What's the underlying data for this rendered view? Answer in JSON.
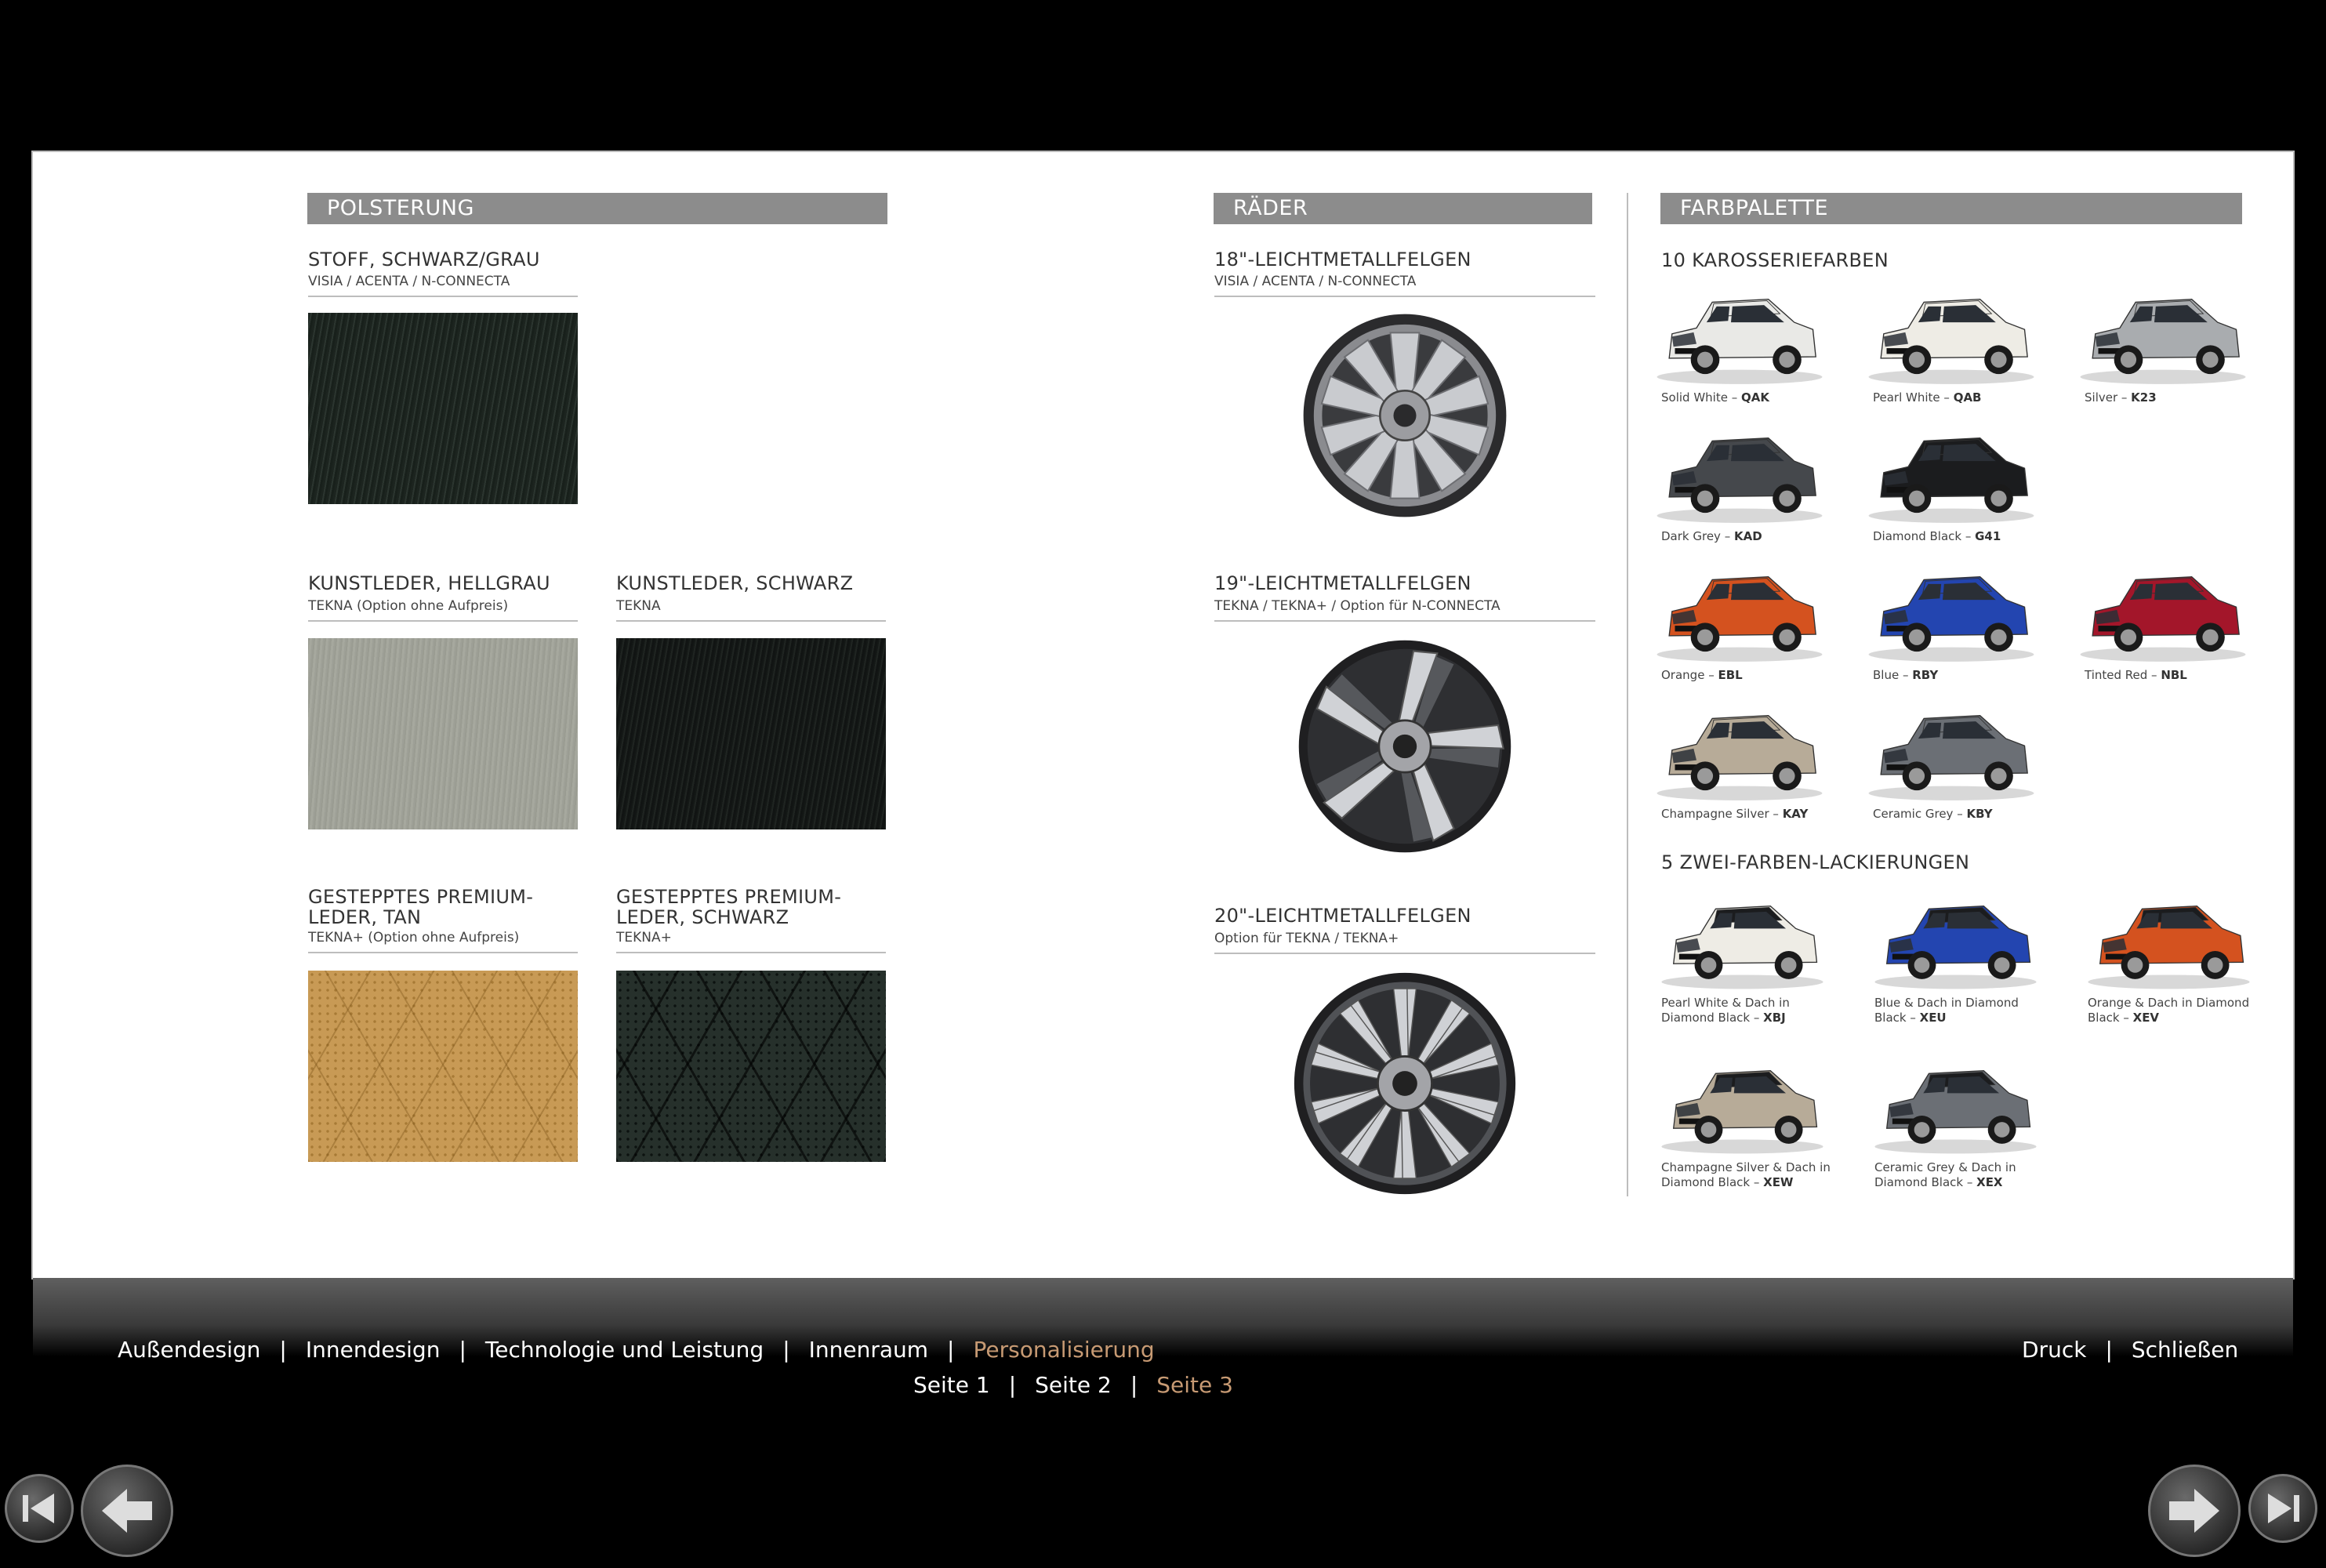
{
  "upholstery": {
    "heading": "POLSTERUNG",
    "items": [
      {
        "title": "STOFF, SCHWARZ/GRAU",
        "sub": "VISIA / ACENTA / N-CONNECTA"
      },
      {
        "title": "KUNSTLEDER, HELLGRAU",
        "sub": "TEKNA (Option ohne Aufpreis)"
      },
      {
        "title": "KUNSTLEDER, SCHWARZ",
        "sub": "TEKNA"
      },
      {
        "title": "GESTEPPTES PREMIUM-\nLEDER, TAN",
        "sub": "TEKNA+ (Option ohne Aufpreis)"
      },
      {
        "title": "GESTEPPTES PREMIUM-\nLEDER, SCHWARZ",
        "sub": "TEKNA+"
      }
    ]
  },
  "wheels": {
    "heading": "RÄDER",
    "items": [
      {
        "title": "18\"-LEICHTMETALLFELGEN",
        "sub": "VISIA / ACENTA / N-CONNECTA"
      },
      {
        "title": "19\"-LEICHTMETALLFELGEN",
        "sub": "TEKNA / TEKNA+ / Option für N-CONNECTA"
      },
      {
        "title": "20\"-LEICHTMETALLFELGEN",
        "sub": "Option für TEKNA / TEKNA+"
      }
    ]
  },
  "palette": {
    "heading": "FARBPALETTE",
    "body_colors_title": "10 KAROSSERIEFARBEN",
    "body_colors": [
      {
        "name": "Solid White – ",
        "code": "QAK",
        "color": "#e9e9e6",
        "roof": "#e9e9e6"
      },
      {
        "name": "Pearl White – ",
        "code": "QAB",
        "color": "#eeece5",
        "roof": "#eeece5"
      },
      {
        "name": "Silver – ",
        "code": "K23",
        "color": "#a9acaf",
        "roof": "#a9acaf"
      },
      {
        "name": "Dark Grey – ",
        "code": "KAD",
        "color": "#45484c",
        "roof": "#45484c"
      },
      {
        "name": "Diamond Black – ",
        "code": "G41",
        "color": "#1b1c1e",
        "roof": "#1b1c1e"
      },
      {
        "name": "Orange – ",
        "code": "EBL",
        "color": "#d4521f",
        "roof": "#d4521f"
      },
      {
        "name": "Blue – ",
        "code": "RBY",
        "color": "#2345b0",
        "roof": "#2345b0"
      },
      {
        "name": "Tinted Red – ",
        "code": "NBL",
        "color": "#a3162a",
        "roof": "#a3162a"
      },
      {
        "name": "Champagne Silver – ",
        "code": "KAY",
        "color": "#b7ab98",
        "roof": "#b7ab98"
      },
      {
        "name": "Ceramic Grey – ",
        "code": "KBY",
        "color": "#6b6f75",
        "roof": "#6b6f75"
      }
    ],
    "two_tone_title": "5 ZWEI-FARBEN-LACKIERUNGEN",
    "two_tone": [
      {
        "line1": "Pearl White & Dach in",
        "line2": "Diamond Black – ",
        "code": "XBJ",
        "color": "#eeece5",
        "roof": "#1b1c1e"
      },
      {
        "line1": "Blue & Dach in Diamond",
        "line2": "Black – ",
        "code": "XEU",
        "color": "#2345b0",
        "roof": "#1b1c1e"
      },
      {
        "line1": "Orange & Dach in Diamond",
        "line2": "Black – ",
        "code": "XEV",
        "color": "#d4521f",
        "roof": "#1b1c1e"
      },
      {
        "line1": "Champagne Silver & Dach in",
        "line2": "Diamond Black – ",
        "code": "XEW",
        "color": "#b7ab98",
        "roof": "#1b1c1e"
      },
      {
        "line1": "Ceramic Grey & Dach in",
        "line2": "Diamond Black – ",
        "code": "XEX",
        "color": "#6b6f75",
        "roof": "#1b1c1e"
      }
    ]
  },
  "footer": {
    "sections": [
      "Außendesign",
      "Innendesign",
      "Technologie und Leistung",
      "Innenraum",
      "Personalisierung"
    ],
    "pages": [
      "Seite 1",
      "Seite 2",
      "Seite 3"
    ],
    "print": "Druck",
    "close": "Schließen",
    "active_color": "#c79a73"
  }
}
